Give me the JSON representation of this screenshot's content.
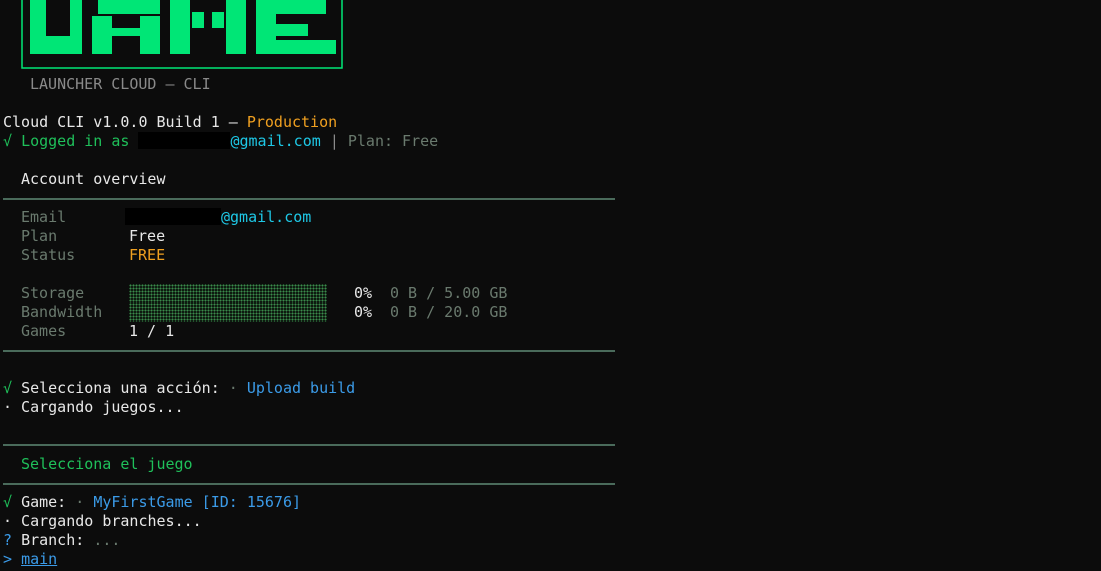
{
  "logo": {
    "subtitle": "LAUNCHER CLOUD — CLI",
    "color": "#00e676"
  },
  "header": {
    "version_text": "Cloud CLI v1.0.0 Build 1 —",
    "environment": "Production",
    "check_mark": "√",
    "logged_in_prefix": "Logged in as",
    "email_domain": "@gmail.com",
    "separator": "|",
    "plan_text": "Plan: Free"
  },
  "account": {
    "title": "Account overview",
    "email_label": "Email",
    "email_domain": "@gmail.com",
    "plan_label": "Plan",
    "plan_value": "Free",
    "status_label": "Status",
    "status_value": "FREE",
    "storage_label": "Storage",
    "storage_pct": "0%",
    "storage_qty": "0 B / 5.00 GB",
    "bandwidth_label": "Bandwidth",
    "bandwidth_pct": "0%",
    "bandwidth_qty": "0 B / 20.0 GB",
    "games_label": "Games",
    "games_value": "1 / 1"
  },
  "action": {
    "check_mark": "√",
    "prompt": "Selecciona una acción:",
    "bullet": "·",
    "selected": "Upload build",
    "loading": "· Cargando juegos..."
  },
  "game_section": {
    "title": "Selecciona el juego",
    "check_mark": "√",
    "prompt": "Game:",
    "bullet": "·",
    "selected": "MyFirstGame [ID: 15676]",
    "loading": "· Cargando branches...",
    "question_mark": "?",
    "branch_prompt": "Branch:",
    "branch_hint": "...",
    "cursor": ">",
    "branch_option": "main"
  }
}
